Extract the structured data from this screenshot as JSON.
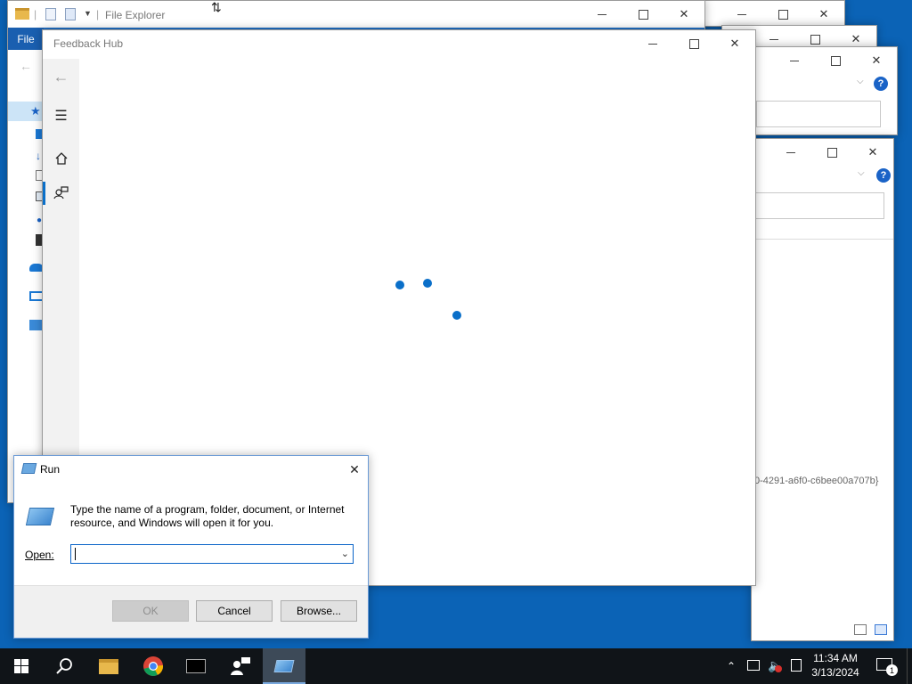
{
  "file_explorer": {
    "title": "File Explorer",
    "ribbon_file_tab": "File",
    "quick_access_separator": "|"
  },
  "background_windows": {
    "partial_guid_text": "0-4291-a6f0-c6bee00a707b}",
    "help_label": "?"
  },
  "feedback_hub": {
    "title": "Feedback Hub",
    "nav_icons": [
      "back-arrow-icon",
      "hamburger-menu-icon",
      "home-icon",
      "feedback-icon"
    ],
    "loading_dots": 3,
    "accent_color": "#0a6fc9"
  },
  "run_dialog": {
    "title": "Run",
    "description": "Type the name of a program, folder, document, or Internet resource, and Windows will open it for you.",
    "open_label": "Open:",
    "input_value": "",
    "ok_label": "OK",
    "cancel_label": "Cancel",
    "browse_label": "Browse..."
  },
  "taskbar": {
    "items": [
      "start-button",
      "search-button",
      "file-explorer",
      "chrome",
      "terminal",
      "feedback-hub",
      "run"
    ],
    "time": "11:34 AM",
    "date": "3/13/2024",
    "notification_count": "1"
  }
}
